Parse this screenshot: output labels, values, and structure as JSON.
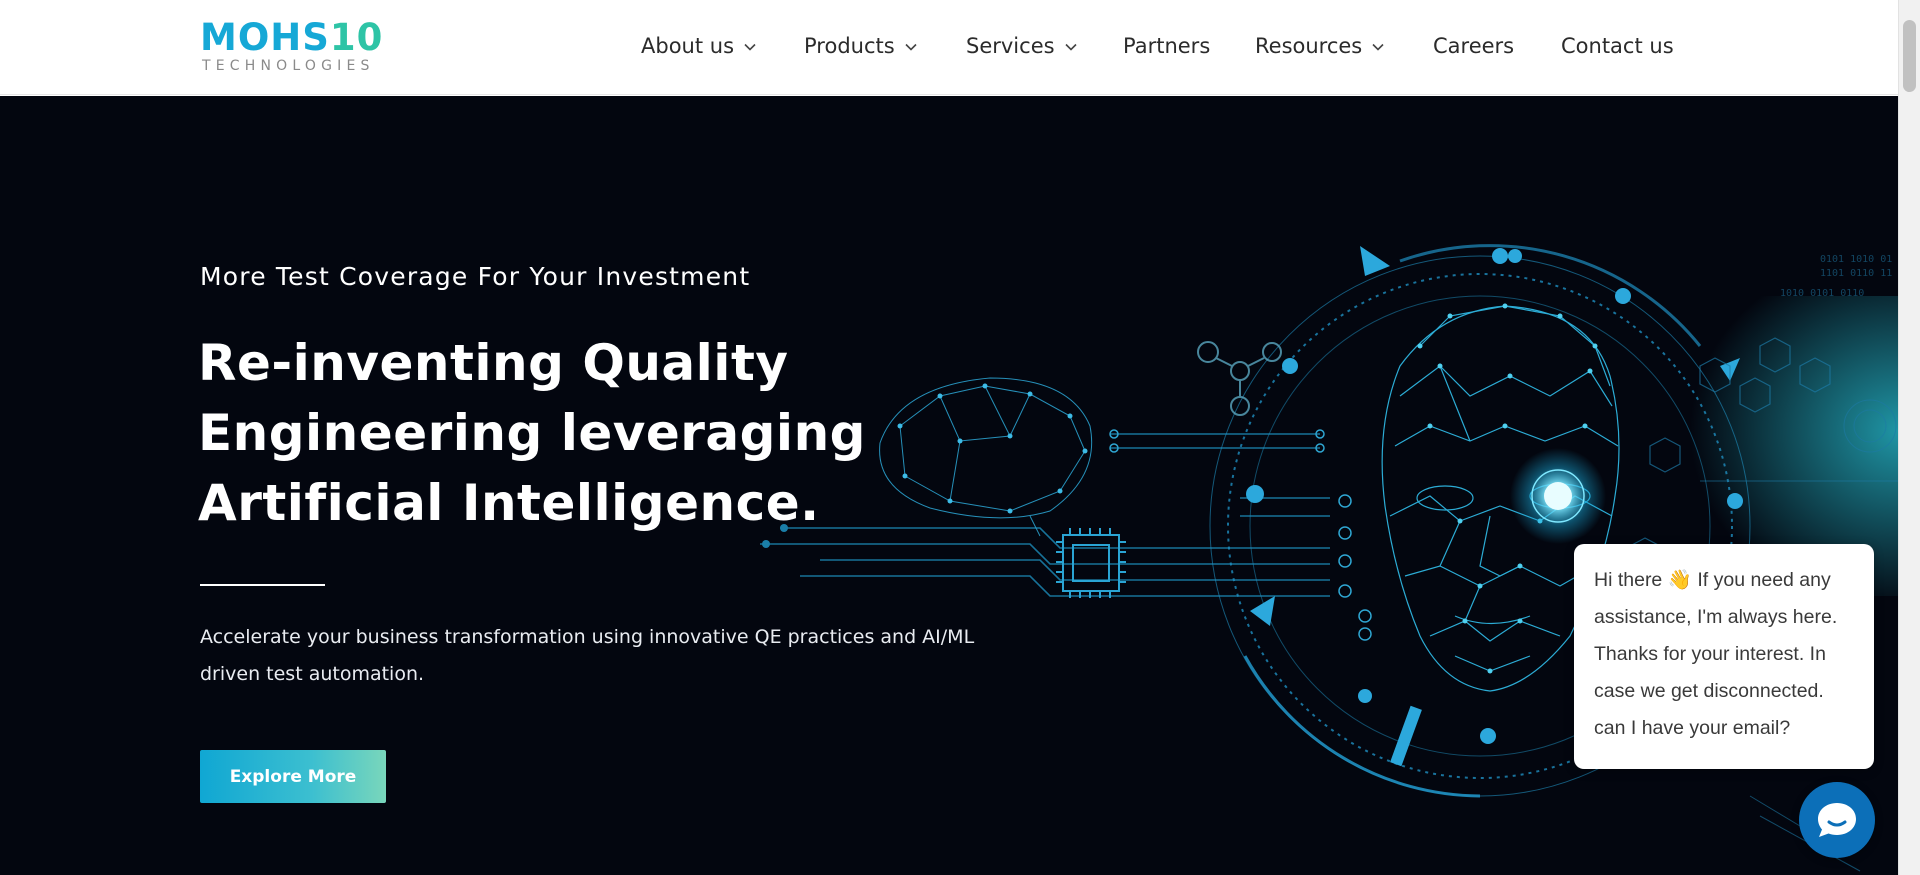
{
  "header": {
    "logo": {
      "main_a": "MOHS",
      "main_b": "10",
      "sub": "TECHNOLOGIES"
    },
    "nav": [
      {
        "label": "About us",
        "has_dropdown": true
      },
      {
        "label": "Products",
        "has_dropdown": true
      },
      {
        "label": "Services",
        "has_dropdown": true
      },
      {
        "label": "Partners",
        "has_dropdown": false
      },
      {
        "label": "Resources",
        "has_dropdown": true
      },
      {
        "label": "Careers",
        "has_dropdown": false
      },
      {
        "label": "Contact us",
        "has_dropdown": false
      }
    ]
  },
  "hero": {
    "tagline": "More Test Coverage For Your Investment",
    "headline_lines": [
      "Re-inventing Quality",
      "Engineering leveraging",
      "Artificial Intelligence."
    ],
    "description": "Accelerate your business transformation using innovative QE practices and AI/ML driven test automation.",
    "cta_label": "Explore More"
  },
  "chat": {
    "message": "Hi there 👋 If you need any assistance, I'm always here. Thanks for your interest. In case we get disconnected. can I have your email?"
  },
  "icons": {
    "nav_dropdown": "chevron-down-icon",
    "chat_launcher": "chat-icon",
    "hero_art": "ai-face-brain-circuit-illustration"
  },
  "colors": {
    "brand_blue": "#16a8d6",
    "brand_teal": "#2ec4a6",
    "hero_bg": "#03060f",
    "cta_gradient_start": "#10a7d3",
    "cta_gradient_end": "#79d6bb",
    "chat_launcher": "#0c6fb8"
  }
}
